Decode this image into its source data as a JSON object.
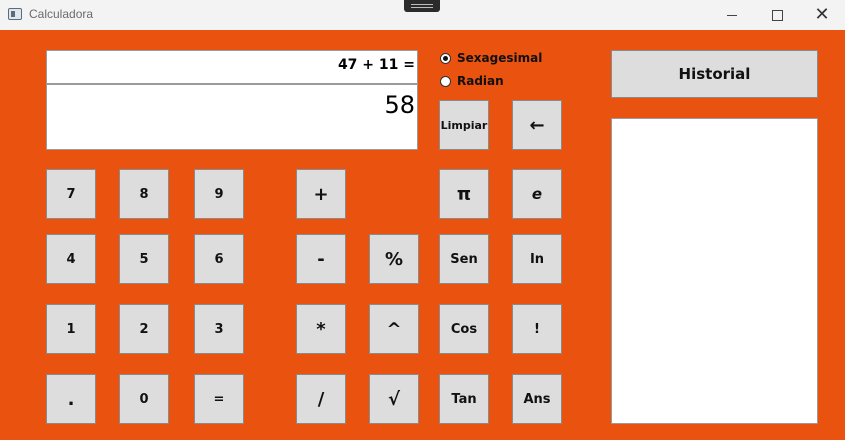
{
  "window": {
    "title": "Calculadora"
  },
  "display": {
    "expression": "47 + 11 =",
    "result": "58"
  },
  "angle_mode": {
    "options": [
      "Sexagesimal",
      "Radian"
    ],
    "selected": "Sexagesimal"
  },
  "buttons": {
    "clear": "Limpiar",
    "backspace": "←",
    "d7": "7",
    "d8": "8",
    "d9": "9",
    "d4": "4",
    "d5": "5",
    "d6": "6",
    "d1": "1",
    "d2": "2",
    "d3": "3",
    "dot": ".",
    "d0": "0",
    "equals": "=",
    "plus": "+",
    "minus": "-",
    "percent": "%",
    "multiply": "*",
    "power": "^",
    "divide": "/",
    "sqrt": "√",
    "pi": "π",
    "e": "e",
    "sin": "Sen",
    "ln": "In",
    "cos": "Cos",
    "factorial": "!",
    "tan": "Tan",
    "ans": "Ans"
  },
  "history": {
    "button_label": "Historial",
    "items": []
  },
  "colors": {
    "background": "#e9520f",
    "button": "#dddddd",
    "display": "#ffffff"
  }
}
